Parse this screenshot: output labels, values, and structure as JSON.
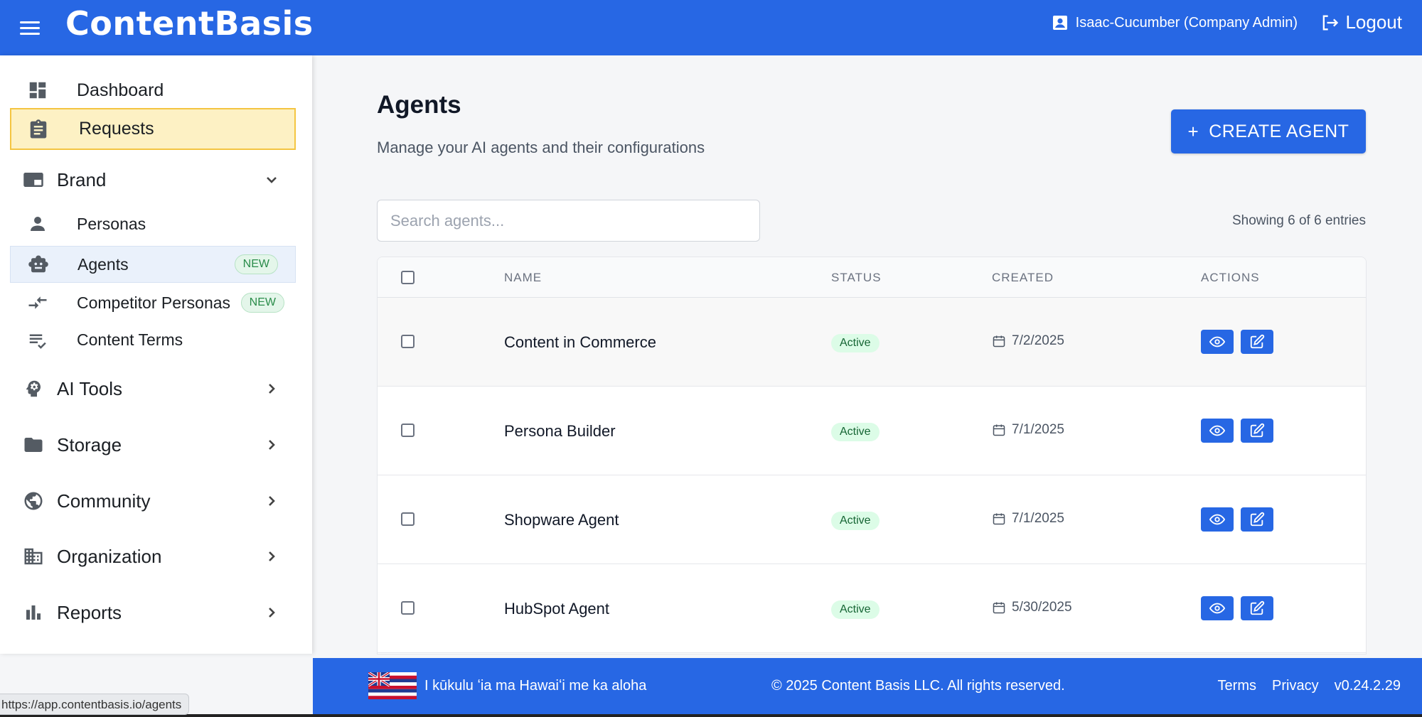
{
  "header": {
    "logo": "ContentBasis",
    "user": "Isaac-Cucumber (Company Admin)",
    "logout_label": "Logout"
  },
  "sidebar": {
    "items": [
      {
        "label": "Dashboard",
        "icon": "dashboard-icon"
      },
      {
        "label": "Requests",
        "icon": "clipboard-icon",
        "state": "highlighted"
      },
      {
        "label": "Brand",
        "icon": "brand-icon",
        "expanded": true
      },
      {
        "label": "Personas",
        "icon": "person-icon"
      },
      {
        "label": "Agents",
        "icon": "robot-icon",
        "badge": "NEW",
        "active": true
      },
      {
        "label": "Competitor Personas",
        "icon": "compare-arrows-icon",
        "badge": "NEW"
      },
      {
        "label": "Content Terms",
        "icon": "checklist-icon"
      },
      {
        "label": "AI Tools",
        "icon": "psychology-icon"
      },
      {
        "label": "Storage",
        "icon": "folder-icon"
      },
      {
        "label": "Community",
        "icon": "globe-icon"
      },
      {
        "label": "Organization",
        "icon": "building-icon"
      },
      {
        "label": "Reports",
        "icon": "bar-chart-icon"
      }
    ]
  },
  "main": {
    "title": "Agents",
    "subtitle": "Manage your AI agents and their configurations",
    "create_button": "CREATE AGENT",
    "search_placeholder": "Search agents...",
    "showing": "Showing 6 of 6 entries",
    "columns": [
      "NAME",
      "STATUS",
      "CREATED",
      "ACTIONS"
    ],
    "rows": [
      {
        "name": "Content in Commerce",
        "status": "Active",
        "created": "7/2/2025"
      },
      {
        "name": "Persona Builder",
        "status": "Active",
        "created": "7/1/2025"
      },
      {
        "name": "Shopware Agent",
        "status": "Active",
        "created": "7/1/2025"
      },
      {
        "name": "HubSpot Agent",
        "status": "Active",
        "created": "5/30/2025"
      }
    ]
  },
  "footer": {
    "motto": "I kūkulu ʻia ma Hawaiʻi me ka aloha",
    "copyright": "© 2025 Content Basis LLC. All rights reserved.",
    "terms": "Terms",
    "privacy": "Privacy",
    "version": "v0.24.2.29"
  },
  "browser_status": {
    "url": "https://app.contentbasis.io/agents"
  },
  "colors": {
    "primary": "#2767e4",
    "highlight": "#fdf1c4",
    "status_active_bg": "#dcfce7",
    "status_active_text": "#166534"
  }
}
